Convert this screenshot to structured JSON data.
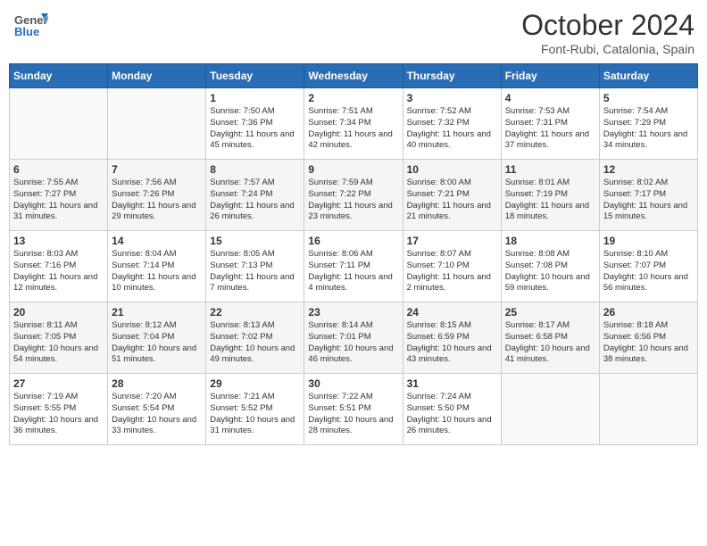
{
  "logo": {
    "line1": "General",
    "line2": "Blue"
  },
  "title": "October 2024",
  "location": "Font-Rubi, Catalonia, Spain",
  "days_of_week": [
    "Sunday",
    "Monday",
    "Tuesday",
    "Wednesday",
    "Thursday",
    "Friday",
    "Saturday"
  ],
  "weeks": [
    [
      {
        "day": "",
        "content": ""
      },
      {
        "day": "",
        "content": ""
      },
      {
        "day": "1",
        "content": "Sunrise: 7:50 AM\nSunset: 7:36 PM\nDaylight: 11 hours and 45 minutes."
      },
      {
        "day": "2",
        "content": "Sunrise: 7:51 AM\nSunset: 7:34 PM\nDaylight: 11 hours and 42 minutes."
      },
      {
        "day": "3",
        "content": "Sunrise: 7:52 AM\nSunset: 7:32 PM\nDaylight: 11 hours and 40 minutes."
      },
      {
        "day": "4",
        "content": "Sunrise: 7:53 AM\nSunset: 7:31 PM\nDaylight: 11 hours and 37 minutes."
      },
      {
        "day": "5",
        "content": "Sunrise: 7:54 AM\nSunset: 7:29 PM\nDaylight: 11 hours and 34 minutes."
      }
    ],
    [
      {
        "day": "6",
        "content": "Sunrise: 7:55 AM\nSunset: 7:27 PM\nDaylight: 11 hours and 31 minutes."
      },
      {
        "day": "7",
        "content": "Sunrise: 7:56 AM\nSunset: 7:26 PM\nDaylight: 11 hours and 29 minutes."
      },
      {
        "day": "8",
        "content": "Sunrise: 7:57 AM\nSunset: 7:24 PM\nDaylight: 11 hours and 26 minutes."
      },
      {
        "day": "9",
        "content": "Sunrise: 7:59 AM\nSunset: 7:22 PM\nDaylight: 11 hours and 23 minutes."
      },
      {
        "day": "10",
        "content": "Sunrise: 8:00 AM\nSunset: 7:21 PM\nDaylight: 11 hours and 21 minutes."
      },
      {
        "day": "11",
        "content": "Sunrise: 8:01 AM\nSunset: 7:19 PM\nDaylight: 11 hours and 18 minutes."
      },
      {
        "day": "12",
        "content": "Sunrise: 8:02 AM\nSunset: 7:17 PM\nDaylight: 11 hours and 15 minutes."
      }
    ],
    [
      {
        "day": "13",
        "content": "Sunrise: 8:03 AM\nSunset: 7:16 PM\nDaylight: 11 hours and 12 minutes."
      },
      {
        "day": "14",
        "content": "Sunrise: 8:04 AM\nSunset: 7:14 PM\nDaylight: 11 hours and 10 minutes."
      },
      {
        "day": "15",
        "content": "Sunrise: 8:05 AM\nSunset: 7:13 PM\nDaylight: 11 hours and 7 minutes."
      },
      {
        "day": "16",
        "content": "Sunrise: 8:06 AM\nSunset: 7:11 PM\nDaylight: 11 hours and 4 minutes."
      },
      {
        "day": "17",
        "content": "Sunrise: 8:07 AM\nSunset: 7:10 PM\nDaylight: 11 hours and 2 minutes."
      },
      {
        "day": "18",
        "content": "Sunrise: 8:08 AM\nSunset: 7:08 PM\nDaylight: 10 hours and 59 minutes."
      },
      {
        "day": "19",
        "content": "Sunrise: 8:10 AM\nSunset: 7:07 PM\nDaylight: 10 hours and 56 minutes."
      }
    ],
    [
      {
        "day": "20",
        "content": "Sunrise: 8:11 AM\nSunset: 7:05 PM\nDaylight: 10 hours and 54 minutes."
      },
      {
        "day": "21",
        "content": "Sunrise: 8:12 AM\nSunset: 7:04 PM\nDaylight: 10 hours and 51 minutes."
      },
      {
        "day": "22",
        "content": "Sunrise: 8:13 AM\nSunset: 7:02 PM\nDaylight: 10 hours and 49 minutes."
      },
      {
        "day": "23",
        "content": "Sunrise: 8:14 AM\nSunset: 7:01 PM\nDaylight: 10 hours and 46 minutes."
      },
      {
        "day": "24",
        "content": "Sunrise: 8:15 AM\nSunset: 6:59 PM\nDaylight: 10 hours and 43 minutes."
      },
      {
        "day": "25",
        "content": "Sunrise: 8:17 AM\nSunset: 6:58 PM\nDaylight: 10 hours and 41 minutes."
      },
      {
        "day": "26",
        "content": "Sunrise: 8:18 AM\nSunset: 6:56 PM\nDaylight: 10 hours and 38 minutes."
      }
    ],
    [
      {
        "day": "27",
        "content": "Sunrise: 7:19 AM\nSunset: 5:55 PM\nDaylight: 10 hours and 36 minutes."
      },
      {
        "day": "28",
        "content": "Sunrise: 7:20 AM\nSunset: 5:54 PM\nDaylight: 10 hours and 33 minutes."
      },
      {
        "day": "29",
        "content": "Sunrise: 7:21 AM\nSunset: 5:52 PM\nDaylight: 10 hours and 31 minutes."
      },
      {
        "day": "30",
        "content": "Sunrise: 7:22 AM\nSunset: 5:51 PM\nDaylight: 10 hours and 28 minutes."
      },
      {
        "day": "31",
        "content": "Sunrise: 7:24 AM\nSunset: 5:50 PM\nDaylight: 10 hours and 26 minutes."
      },
      {
        "day": "",
        "content": ""
      },
      {
        "day": "",
        "content": ""
      }
    ]
  ]
}
